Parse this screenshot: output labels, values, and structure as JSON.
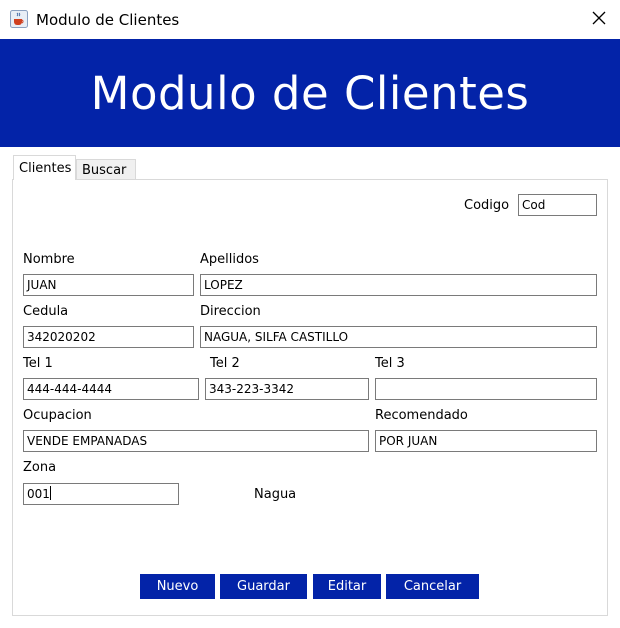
{
  "colors": {
    "banner": "#0323a8",
    "button": "#0323a8",
    "window_bg": "#ffffff",
    "text": "#000000"
  },
  "window": {
    "title": "Modulo de Clientes",
    "icon": "java-cup-icon",
    "close_icon": "close-icon"
  },
  "banner": {
    "title": "Modulo de Clientes"
  },
  "tabs": [
    {
      "label": "Clientes",
      "active": true
    },
    {
      "label": "Buscar",
      "active": false
    }
  ],
  "form": {
    "codigo": {
      "label": "Codigo",
      "value": "Cod"
    },
    "nombre": {
      "label": "Nombre",
      "value": "JUAN"
    },
    "apellidos": {
      "label": "Apellidos",
      "value": "LOPEZ"
    },
    "cedula": {
      "label": "Cedula",
      "value": "342020202"
    },
    "direccion": {
      "label": "Direccion",
      "value": "NAGUA, SILFA CASTILLO"
    },
    "tel1": {
      "label": "Tel 1",
      "value": "444-444-4444"
    },
    "tel2": {
      "label": "Tel 2",
      "value": "343-223-3342"
    },
    "tel3": {
      "label": "Tel 3",
      "value": ""
    },
    "ocupacion": {
      "label": "Ocupacion",
      "value": "VENDE EMPANADAS"
    },
    "recomendado": {
      "label": "Recomendado",
      "value": "POR JUAN"
    },
    "zona": {
      "label": "Zona",
      "value": "001",
      "description": "Nagua"
    }
  },
  "buttons": {
    "nuevo": "Nuevo",
    "guardar": "Guardar",
    "editar": "Editar",
    "cancelar": "Cancelar"
  }
}
